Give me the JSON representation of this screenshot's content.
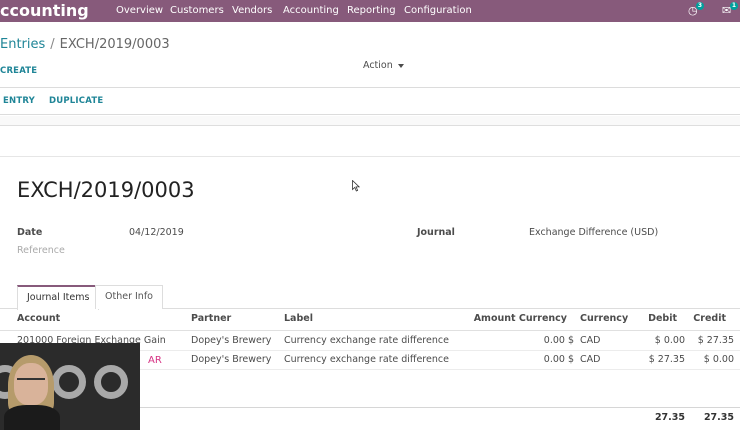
{
  "navbar": {
    "app_title": "ccounting",
    "menu": [
      "Overview",
      "Customers",
      "Vendors",
      "Accounting",
      "Reporting",
      "Configuration"
    ],
    "activity_count": "3",
    "message_count": "1"
  },
  "control_panel": {
    "breadcrumb_parent": "Entries",
    "breadcrumb_separator": "/",
    "breadcrumb_current": "EXCH/2019/0003",
    "create_label": "CREATE",
    "action_label": "Action"
  },
  "statusbar": {
    "entry_label": "ENTRY",
    "duplicate_label": "DUPLICATE"
  },
  "entry": {
    "title": "EXCH/2019/0003",
    "date_label": "Date",
    "date_value": "04/12/2019",
    "reference_label": "Reference",
    "journal_label": "Journal",
    "journal_value": "Exchange Difference (USD)"
  },
  "tabs": [
    "Journal Items",
    "Other Info"
  ],
  "table": {
    "headers": {
      "account": "Account",
      "partner": "Partner",
      "label": "Label",
      "amount_currency": "Amount Currency",
      "currency": "Currency",
      "debit": "Debit",
      "credit": "Credit"
    },
    "rows": [
      {
        "account": "201000 Foreign Exchange Gain",
        "partner": "Dopey's Brewery",
        "label": "Currency exchange rate difference",
        "amount_currency": "0.00 $",
        "currency": "CAD",
        "debit": "$ 0.00",
        "credit": "$ 27.35"
      },
      {
        "account": "",
        "partner": "Dopey's Brewery",
        "label": "Currency exchange rate difference",
        "amount_currency": "0.00 $",
        "currency": "CAD",
        "debit": "$ 27.35",
        "credit": "$ 0.00"
      }
    ],
    "partial_account_text": "AR",
    "total_debit": "27.35",
    "total_credit": "27.35"
  },
  "colors": {
    "brand": "#875a7b",
    "link": "#1f8597",
    "badge": "#00a09d"
  }
}
